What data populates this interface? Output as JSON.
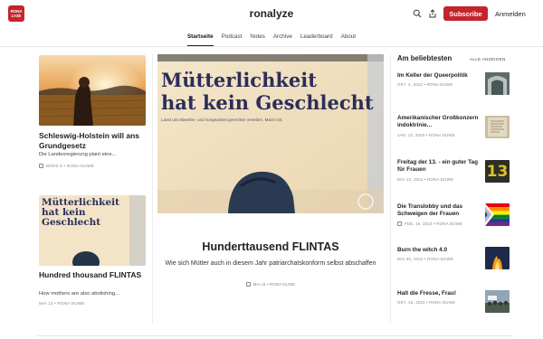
{
  "header": {
    "logo_text": "RONA\nLYZE",
    "site_title": "ronalyze",
    "subscribe_label": "Subscribe",
    "signin_label": "Anmelden"
  },
  "nav": {
    "items": [
      "Startseite",
      "Podcast",
      "Notes",
      "Archive",
      "Leaderboard",
      "About"
    ],
    "active": "Startseite"
  },
  "left": {
    "post1": {
      "title": "Schleswig-Holstein will ans Grundgesetz",
      "subtitle": "Die Landesregierung plant eine...",
      "meta": "MÄRZ 6 • RONA DUWE"
    },
    "post2": {
      "image_text_line1": "Mütterlichkeit",
      "image_text_line2": "hat kein Geschlecht",
      "title": "Hundred thousand FLINTAS",
      "subtitle": "How mothers are also abolishing...",
      "meta": "MAI 12 • RONA DUWE"
    }
  },
  "hero": {
    "image_text_line1": "Mütterlichkeit",
    "image_text_line2": "hat kein Geschlecht",
    "image_small_text": "Lasst uns Biwerbs- und Sorgearbeit gerechter verteilen. Mach mit.",
    "title": "Hunderttausend FLINTAS",
    "subtitle": "Wie sich Mütter auch in diesem Jahr patriarchatskonform selbst abschaffen",
    "meta": "MAI 11 • RONA DUWE"
  },
  "popular": {
    "header": "Am beliebtesten",
    "see_all": "ALLE ANZEIGEN",
    "items": [
      {
        "title": "Im Keller der Queerpolitik",
        "meta": "OKT. 4, 2022 • RONA DUWE"
      },
      {
        "title": "Amerikanischer Großkonzern indoktrinie...",
        "meta": "JAN. 13, 2023 • RONA DUWE"
      },
      {
        "title": "Freitag der 13. - ein guter Tag für Frauen",
        "meta": "MAI 13, 2022 • RONA DUWE",
        "thumb_text": "13"
      },
      {
        "title": "Die Translobby und das Schweigen der Frauen",
        "meta": "FEB. 15, 2023 • RONA DUWE"
      },
      {
        "title": "Burn the witch 4.0",
        "meta": "MAI 30, 2022 • RONA DUWE"
      },
      {
        "title": "Halt die Fresse, Frau!",
        "meta": "OKT. 15, 2022 • RONA DUWE"
      }
    ]
  },
  "colors": {
    "brand": "#c4242b"
  }
}
